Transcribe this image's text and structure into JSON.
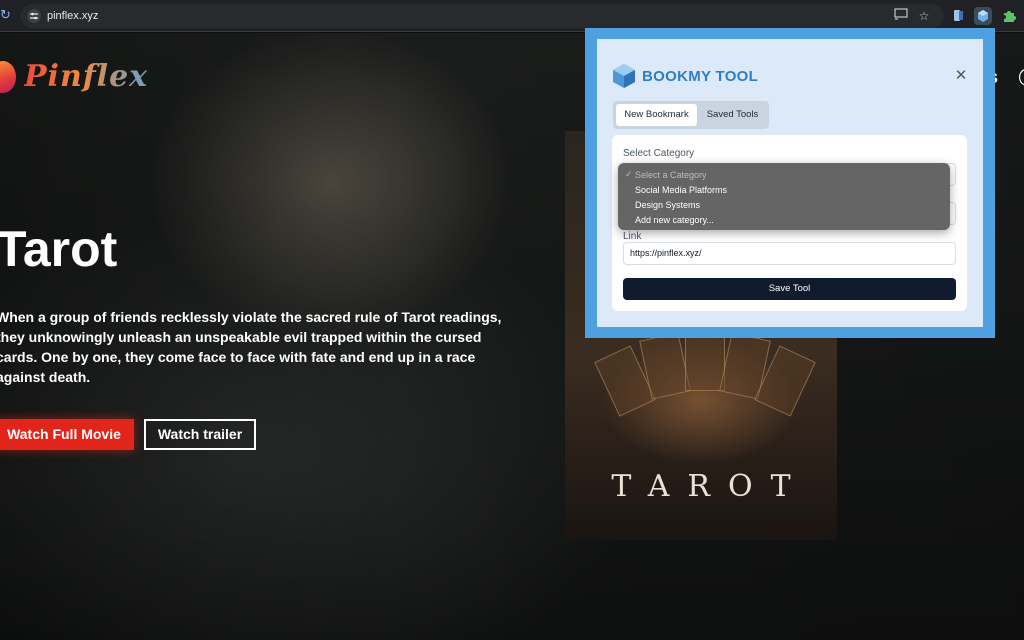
{
  "browser": {
    "url": "pinflex.xyz",
    "reload_icon": "reload-icon",
    "site_info_icon": "tune-icon",
    "cast_icon": "cast-icon",
    "bookmark_icon": "star-icon"
  },
  "site": {
    "logo_text": "Pinflex",
    "nav_fragment": "s",
    "hero": {
      "title": "Tarot",
      "description": "When a group of friends recklessly violate the sacred rule of Tarot readings, they unknowingly unleash an unspeakable evil trapped within the cursed cards. One by one, they come face to face with fate and end up in a race against death.",
      "watch_label": "Watch Full Movie",
      "trailer_label": "Watch trailer"
    },
    "poster_title": "TAROT"
  },
  "popup": {
    "title": "BOOKMY TOOL",
    "tabs": [
      "New Bookmark",
      "Saved Tools"
    ],
    "category_label": "Select Category",
    "category_options": [
      "Select a Category",
      "Social Media Platforms",
      "Design Systems",
      "Add new category..."
    ],
    "link_label": "Link",
    "link_value": "https://pinflex.xyz/",
    "save_label": "Save Tool"
  },
  "colors": {
    "accent_red": "#e1251b",
    "popup_border": "#4ea0e0",
    "popup_title": "#2f7fc4",
    "save_button": "#111b2e"
  }
}
